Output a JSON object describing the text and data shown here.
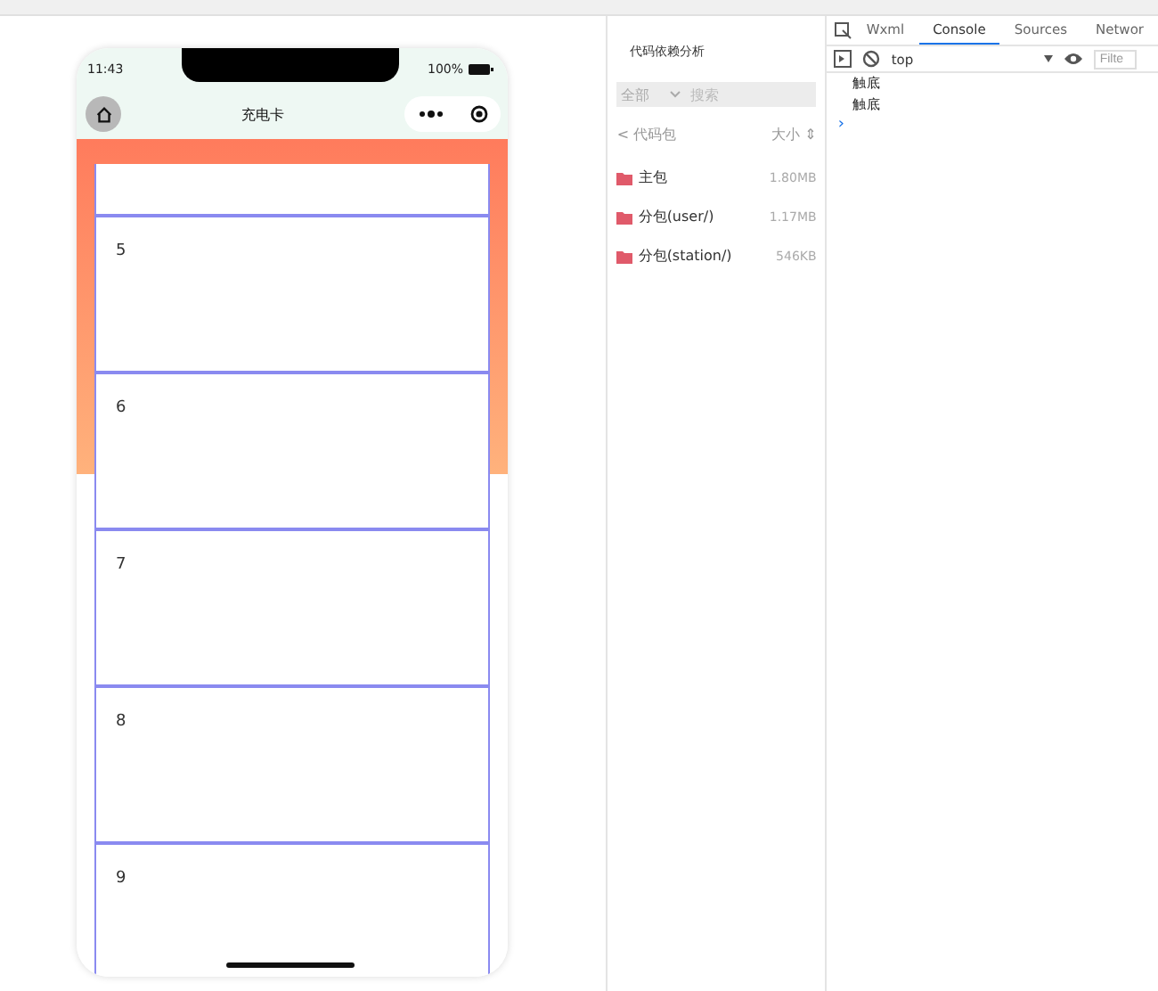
{
  "phone": {
    "status_bar": {
      "time": "11:43",
      "battery": "100%"
    },
    "nav_bar": {
      "title": "充电卡"
    },
    "cards": [
      {
        "label": "5"
      },
      {
        "label": "6"
      },
      {
        "label": "7"
      },
      {
        "label": "8"
      },
      {
        "label": "9"
      }
    ]
  },
  "dependency_panel": {
    "title": "代码依赖分析",
    "filter": {
      "value": "全部"
    },
    "search": {
      "placeholder": "搜索"
    },
    "header": {
      "back": "< 代码包",
      "size": "大小 ⇕"
    },
    "packages": [
      {
        "name": "主包",
        "size": "1.80MB"
      },
      {
        "name": "分包(user/)",
        "size": "1.17MB"
      },
      {
        "name": "分包(station/)",
        "size": "546KB"
      }
    ]
  },
  "devtools": {
    "tabs": [
      {
        "label": "Wxml",
        "selected": false
      },
      {
        "label": "Console",
        "selected": true
      },
      {
        "label": "Sources",
        "selected": false
      },
      {
        "label": "Networ",
        "selected": false
      }
    ],
    "context": "top",
    "filter": {
      "placeholder": "Filte"
    },
    "console_lines": [
      "触底",
      "触底"
    ],
    "prompt": "›"
  }
}
